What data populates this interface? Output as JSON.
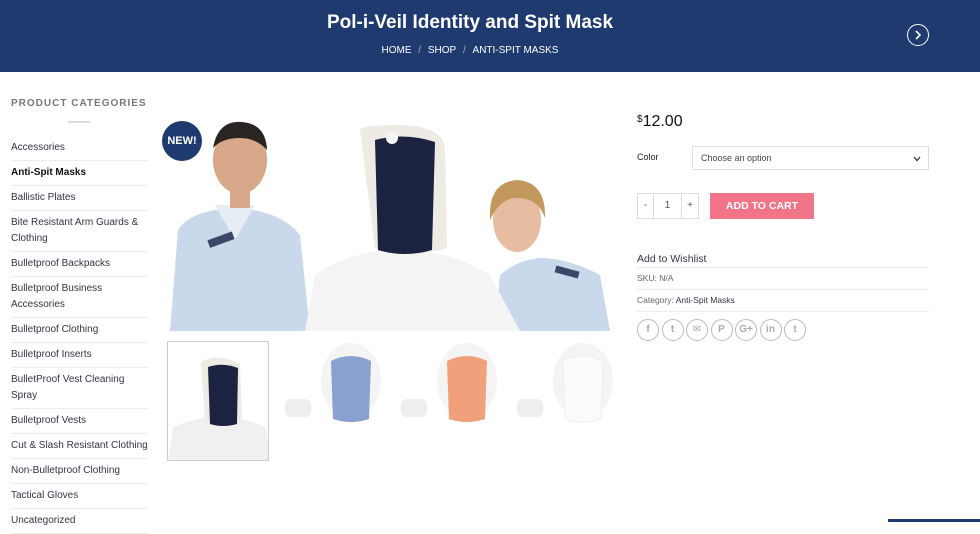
{
  "header": {
    "title": "Pol-i-Veil Identity and Spit Mask",
    "breadcrumb": [
      "HOME",
      "SHOP",
      "ANTI-SPIT MASKS"
    ],
    "separator": "/",
    "next_icon": "chevron-right-circle-icon"
  },
  "sidebar": {
    "title": "PRODUCT CATEGORIES",
    "items": [
      "Accessories",
      "Anti-Spit Masks",
      "Ballistic Plates",
      "Bite Resistant Arm Guards & Clothing",
      "Bulletproof Backpacks",
      "Bulletproof Business Accessories",
      "Bulletproof Clothing",
      "Bulletproof Inserts",
      "BulletProof Vest Cleaning Spray",
      "Bulletproof Vests",
      "Cut & Slash Resistant Clothing",
      "Non-Bulletproof Clothing",
      "Tactical Gloves",
      "Uncategorized"
    ],
    "active_item": "Anti-Spit Masks"
  },
  "product": {
    "badge": "NEW!",
    "currency": "$",
    "price": "12.00",
    "color_label": "Color",
    "color_placeholder": "Choose an option",
    "qty_minus": "-",
    "qty_value": "1",
    "qty_plus": "+",
    "add_to_cart": "ADD TO CART",
    "wishlist": "Add to Wishlist",
    "sku": "SKU: N/A",
    "category_label": "Category:",
    "category_value": "Anti-Spit Masks",
    "share_icons": [
      "facebook-icon",
      "twitter-icon",
      "email-icon",
      "pinterest-icon",
      "google-plus-icon",
      "linkedin-icon",
      "tumblr-icon"
    ],
    "share_glyphs": [
      "f",
      "t",
      "✉",
      "P",
      "G+",
      "in",
      "t"
    ]
  },
  "thumbnails": [
    {
      "mask_color": "#1c2340"
    },
    {
      "mask_color": "#8aa0cf"
    },
    {
      "mask_color": "#f0a07a"
    },
    {
      "mask_color": "#f3f3f3"
    }
  ],
  "colors": {
    "brand": "#1e3a6e",
    "button": "#f17489",
    "shirt": "#c9d8ea"
  }
}
